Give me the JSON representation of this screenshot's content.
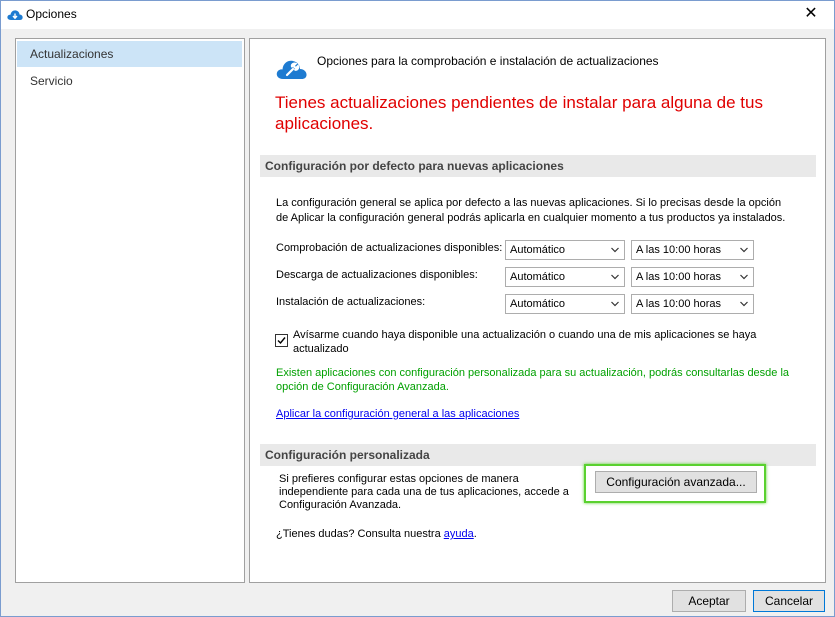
{
  "window": {
    "title": "Opciones",
    "close_glyph": "✕"
  },
  "sidebar": {
    "items": [
      {
        "label": "Actualizaciones",
        "selected": true
      },
      {
        "label": "Servicio",
        "selected": false
      }
    ]
  },
  "main": {
    "header": "Opciones para la comprobación e instalación de actualizaciones",
    "warning": "Tienes actualizaciones pendientes de instalar para alguna de tus aplicaciones.",
    "default_section": {
      "title": "Configuración por defecto para nuevas aplicaciones",
      "description": "La configuración general se aplica por defecto a las nuevas aplicaciones. Si lo precisas desde la opción de Aplicar la configuración general podrás aplicarla en cualquier momento a tus productos ya instalados.",
      "rows": [
        {
          "label": "Comprobación de actualizaciones disponibles:",
          "mode": "Automático",
          "time": "A las 10:00 horas"
        },
        {
          "label": "Descarga de actualizaciones disponibles:",
          "mode": "Automático",
          "time": "A las 10:00 horas"
        },
        {
          "label": "Instalación de actualizaciones:",
          "mode": "Automático",
          "time": "A las 10:00 horas"
        }
      ],
      "notify_checkbox": {
        "label": "Avísarme cuando haya disponible una actualización o cuando una de mis aplicaciones se haya actualizado",
        "checked": true
      },
      "info": "Existen aplicaciones con configuración personalizada para su actualización, podrás consultarlas desde la opción de Configuración Avanzada.",
      "apply_link": "Aplicar la configuración general a las aplicaciones"
    },
    "custom_section": {
      "title": "Configuración personalizada",
      "description": "Si prefieres configurar estas opciones de manera independiente para cada una de tus aplicaciones, accede a Configuración Avanzada.",
      "advanced_button": "Configuración avanzada..."
    },
    "help": {
      "prefix": "¿Tienes dudas? Consulta nuestra ",
      "link": "ayuda",
      "suffix": "."
    }
  },
  "footer": {
    "ok_label": "Aceptar",
    "cancel_label": "Cancelar"
  },
  "colors": {
    "accent": "#0078d7",
    "warning": "#e00000",
    "info": "#00a000",
    "highlight": "#5ad12f",
    "selection": "#cce4f7"
  },
  "icons": {
    "app": "cloud-download-icon",
    "header": "cloud-wrench-icon",
    "dropdown": "chevron-down-icon",
    "check": "checkmark-icon"
  }
}
